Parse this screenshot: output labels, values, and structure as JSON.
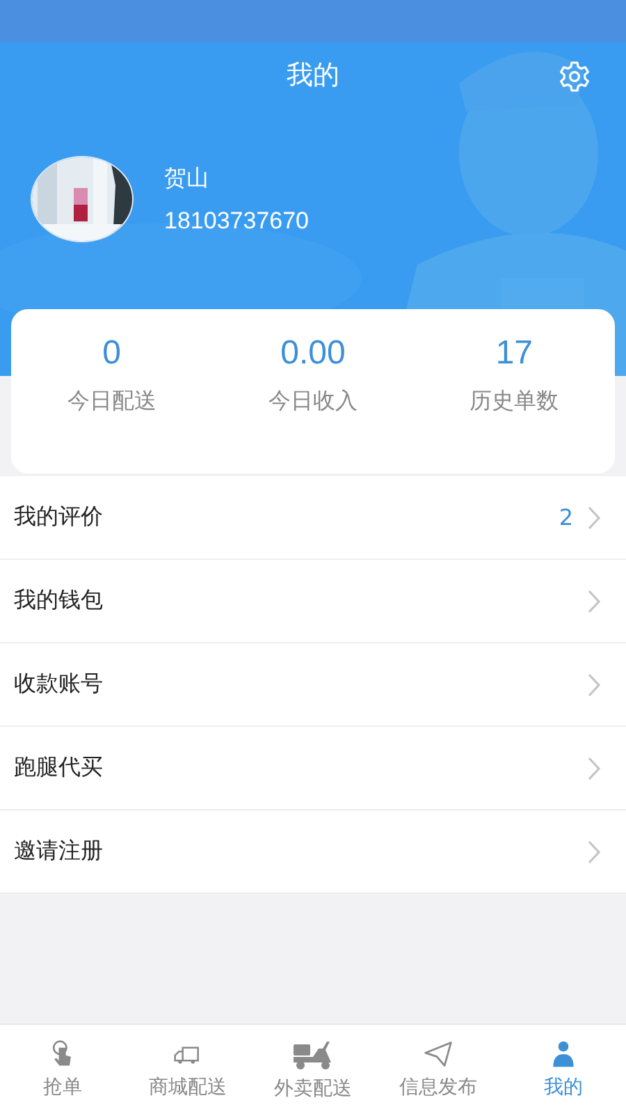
{
  "header": {
    "title": "我的"
  },
  "profile": {
    "name": "贺山",
    "phone": "18103737670"
  },
  "stats": [
    {
      "value": "0",
      "label": "今日配送"
    },
    {
      "value": "0.00",
      "label": "今日收入"
    },
    {
      "value": "17",
      "label": "历史单数"
    }
  ],
  "menu": [
    {
      "label": "我的评价",
      "badge": "2"
    },
    {
      "label": "我的钱包"
    },
    {
      "label": "收款账号"
    },
    {
      "label": "跑腿代买"
    },
    {
      "label": "邀请注册"
    }
  ],
  "tabs": [
    {
      "label": "抢单",
      "selected": false
    },
    {
      "label": "商城配送",
      "selected": false
    },
    {
      "label": "外卖配送",
      "selected": false
    },
    {
      "label": "信息发布",
      "selected": false
    },
    {
      "label": "我的",
      "selected": true
    }
  ]
}
